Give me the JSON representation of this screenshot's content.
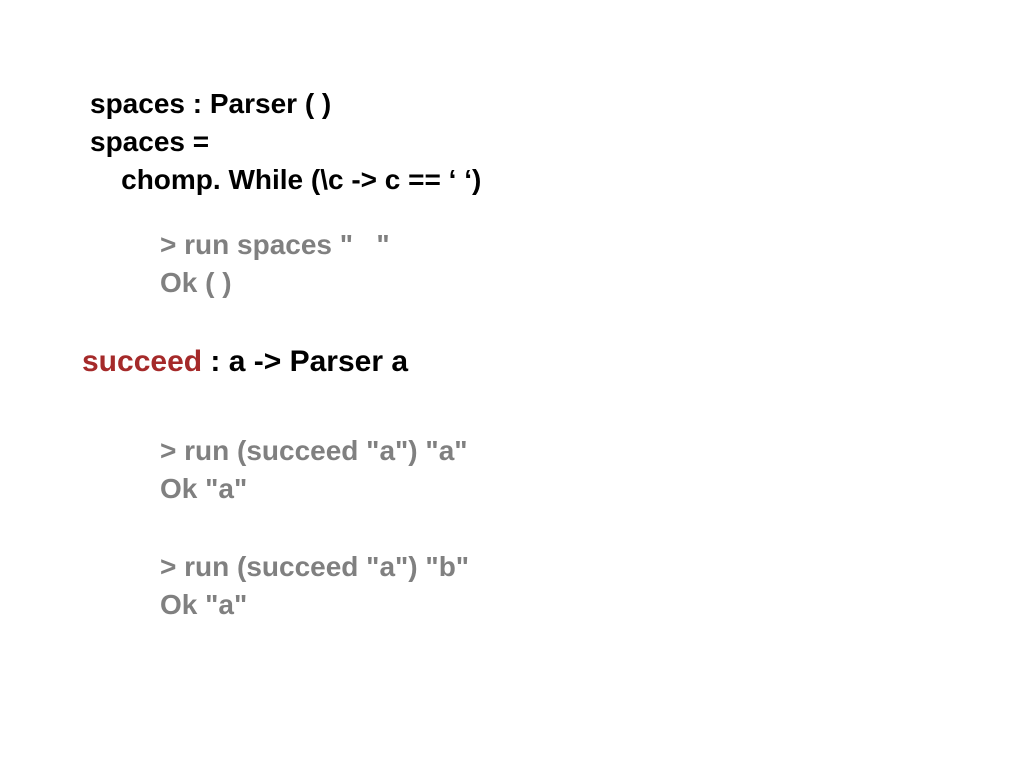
{
  "def": {
    "line1": "spaces : Parser ( )",
    "line2": "spaces =",
    "line3": "    chomp. While (\\c -> c == ‘ ‘)"
  },
  "repl1": {
    "line1": "> run spaces \"   \"",
    "line2": "Ok ( )"
  },
  "sig": {
    "keyword": "succeed",
    "rest": " : a -> Parser a"
  },
  "repl2": {
    "line1": "> run (succeed \"a\") \"a\"",
    "line2": "Ok \"a\""
  },
  "repl3": {
    "line1": "> run (succeed \"a\") \"b\"",
    "line2": "Ok \"a\""
  }
}
